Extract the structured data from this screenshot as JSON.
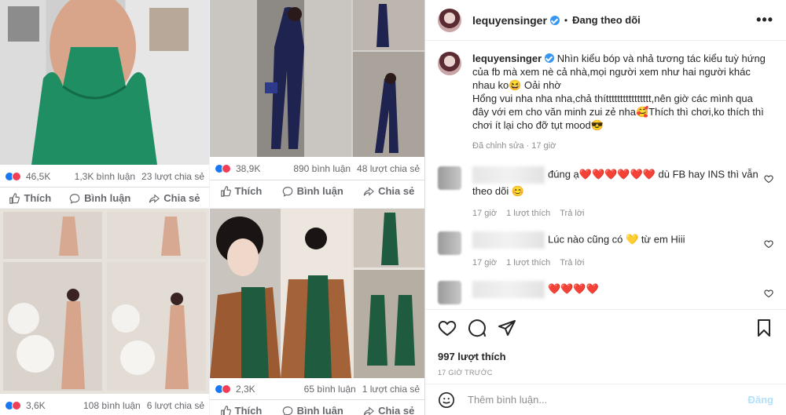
{
  "collage": {
    "posts": [
      {
        "id": "p1",
        "reactions": "46,5K",
        "comments": "1,3K bình luận",
        "shares": "23 lượt chia sẻ",
        "like": "Thích",
        "comment": "Bình luận",
        "share": "Chia sẻ"
      },
      {
        "id": "p2",
        "reactions": "38,9K",
        "comments": "890 bình luận",
        "shares": "48 lượt chia sẻ",
        "like": "Thích",
        "comment": "Bình luận",
        "share": "Chia sẻ"
      },
      {
        "id": "p3",
        "reactions": "3,6K",
        "comments": "108 bình luận",
        "shares": "6 lượt chia sẻ",
        "like": "Thích",
        "comment": "Bình luận",
        "share": "Chia sẻ"
      },
      {
        "id": "p4",
        "reactions": "2,3K",
        "comments": "65 bình luận",
        "shares": "1 lượt chia sẻ",
        "like": "Thích",
        "comment": "Bình luận",
        "share": "Chia sẻ"
      }
    ]
  },
  "header": {
    "username": "lequyensinger",
    "separator": "•",
    "follow_status": "Đang theo dõi",
    "more_icon": "more-horizontal-icon"
  },
  "caption": {
    "username": "lequyensinger",
    "text": "Nhìn kiểu bóp và nhả tương tác kiểu tuỳ hứng của fb mà xem nè cả nhà,mọi người xem như hai người khác nhau ko😆 Oải nhờ",
    "text2": "Hổng vui nha nha nha,chả thítttttttttttttttt,nên giờ các mình qua đây với em cho văn minh zui zẻ nha🥰Thích thì chơi,ko thích thì chơi ít lại cho đỡ tụt mood😎",
    "edited": "Đã chỉnh sửa",
    "time": "17 giờ"
  },
  "comments": [
    {
      "prefix": "đúng ạ",
      "hearts": "❤️❤️❤️❤️❤️❤️",
      "text": " dù FB hay INS thì vẫn theo dõi",
      "emoji": "😊",
      "time": "17 giờ",
      "likes": "1 lượt thích",
      "reply": "Trả lời"
    },
    {
      "prefix": "",
      "hearts": "",
      "text": "Lúc nào cũng có 💛 từ em Hiii",
      "emoji": "",
      "time": "17 giờ",
      "likes": "1 lượt thích",
      "reply": "Trả lời"
    },
    {
      "prefix": "",
      "hearts": "❤️❤️❤️❤️",
      "text": "",
      "emoji": "",
      "time": "",
      "likes": "",
      "reply": ""
    }
  ],
  "footer": {
    "likes": "997 lượt thích",
    "timestamp": "17 GIỜ TRƯỚC",
    "placeholder": "Thêm bình luận...",
    "post": "Đăng"
  },
  "colors": {
    "accent": "#3897f0",
    "like_blue": "#1877f2",
    "love_red": "#f33e58",
    "post_disabled": "#b2dffc"
  }
}
